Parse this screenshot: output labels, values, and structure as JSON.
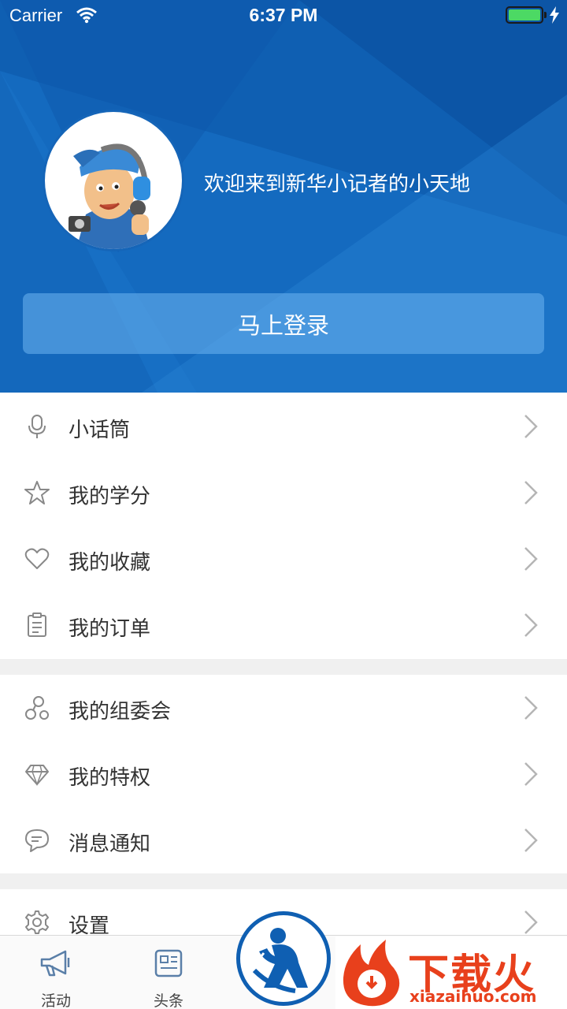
{
  "status_bar": {
    "carrier": "Carrier",
    "time": "6:37 PM",
    "battery_percent": 100
  },
  "header": {
    "welcome_text": "欢迎来到新华小记者的小天地",
    "login_button": "马上登录",
    "avatar_icon": "reporter-mascot-avatar"
  },
  "menu_group_1": [
    {
      "label": "小话筒",
      "icon": "microphone-icon"
    },
    {
      "label": "我的学分",
      "icon": "star-icon"
    },
    {
      "label": "我的收藏",
      "icon": "heart-icon"
    },
    {
      "label": "我的订单",
      "icon": "clipboard-icon"
    }
  ],
  "menu_group_2": [
    {
      "label": "我的组委会",
      "icon": "people-icon"
    },
    {
      "label": "我的特权",
      "icon": "diamond-icon"
    },
    {
      "label": "消息通知",
      "icon": "chat-bubble-icon"
    }
  ],
  "menu_group_3": [
    {
      "label": "设置",
      "icon": "gear-icon"
    }
  ],
  "tabbar": {
    "tabs": [
      {
        "label": "活动",
        "icon": "megaphone-icon"
      },
      {
        "label": "头条",
        "icon": "news-icon"
      }
    ],
    "center_icon": "reporter-logo-icon"
  },
  "watermark": {
    "text": "下载火",
    "url": "xiazaihuo.com"
  },
  "colors": {
    "header_blue": "#0f5fb2",
    "battery_green": "#4cd964",
    "watermark_orange": "#e8401c"
  }
}
